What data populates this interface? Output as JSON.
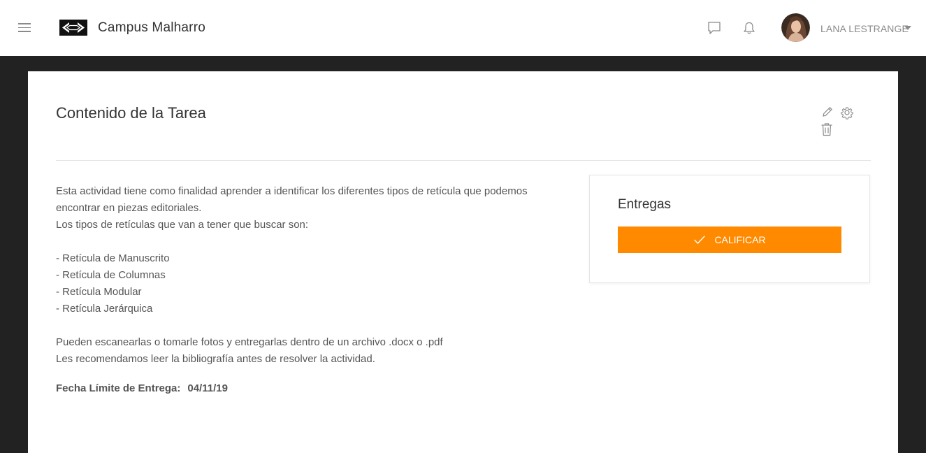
{
  "header": {
    "app_title": "Campus Malharro",
    "icons": {
      "menu": "menu-icon",
      "logo": "campus-logo",
      "chat": "chat-icon",
      "notifications": "bell-icon",
      "user_caret": "caret-down-icon"
    },
    "user": {
      "name": "LANA LESTRANGE"
    }
  },
  "main": {
    "title": "Contenido de la Tarea",
    "toolbar_icons": [
      "pencil-icon",
      "gear-icon",
      "trash-icon"
    ],
    "description_lines": [
      "Esta actividad tiene como finalidad aprender a identificar los diferentes tipos de retícula que podemos",
      "encontrar en piezas editoriales.",
      "Los tipos de retículas que van a tener que buscar son:",
      "",
      "- Retícula de Manuscrito",
      "- Retícula de Columnas",
      "- Retícula Modular",
      "- Retícula Jerárquica",
      "",
      "Pueden escanearlas o tomarle fotos y entregarlas dentro de un archivo .docx o .pdf",
      "Les recomendamos leer la bibliografía antes de resolver la actividad."
    ],
    "deadline_label": "Fecha Límite de Entrega:",
    "deadline_value": "04/11/19"
  },
  "entregas": {
    "title": "Entregas",
    "button_label": "CALIFICAR",
    "button_icon": "check-icon"
  },
  "colors": {
    "accent": "#ff8a00",
    "page_background": "#222222",
    "text": "#555555"
  }
}
